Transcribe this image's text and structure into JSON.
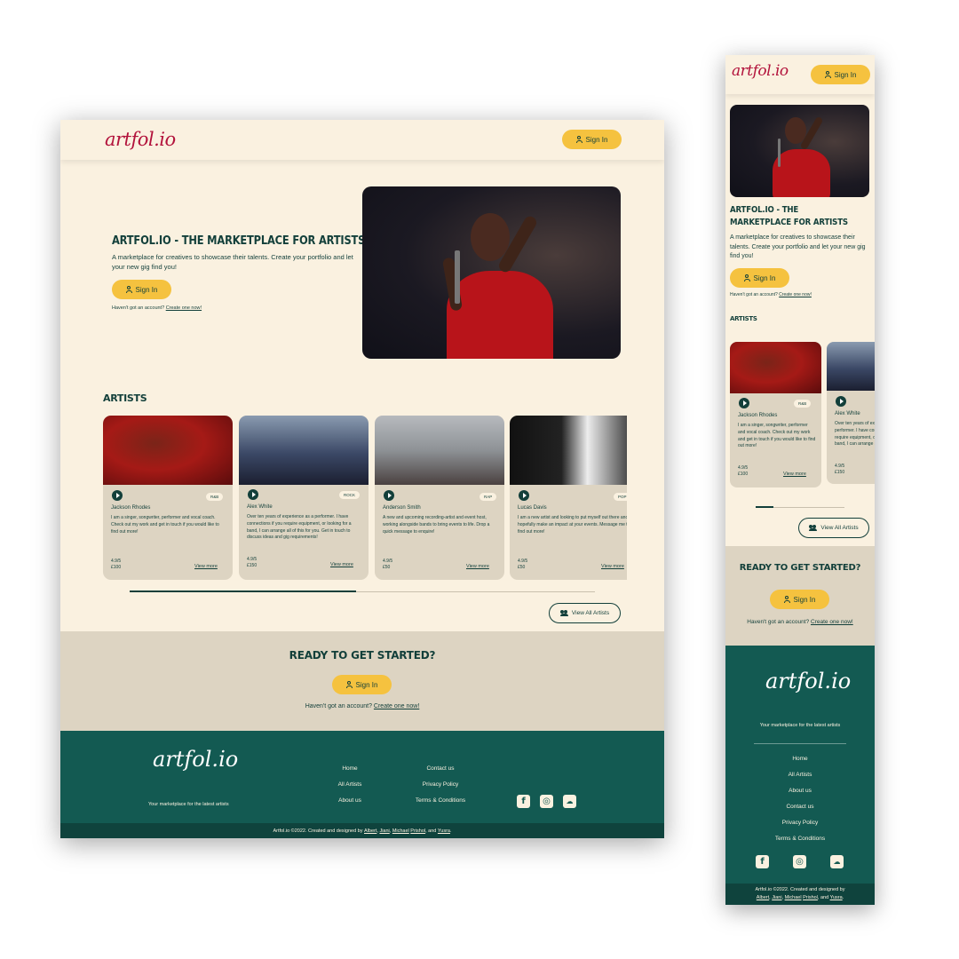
{
  "brand": {
    "logo": "artfol.io",
    "tagline": "Your marketplace for the latest artists"
  },
  "header": {
    "signin_label": "Sign In"
  },
  "hero": {
    "title": "ARTFOL.IO - THE MARKETPLACE FOR ARTISTS",
    "text": "A marketplace for creatives to showcase their talents. Create your portfolio and let your new gig find you!",
    "signin_label": "Sign In",
    "no_account": "Haven't got an account?",
    "create_link": "Create one now!"
  },
  "artists": {
    "title": "ARTISTS",
    "view_all_label": "View All Artists",
    "cards": [
      {
        "name": "Jackson Rhodes",
        "genre": "R&B",
        "desc": "I am a singer, songwriter, performer and vocal coach. Check out my work and get in touch if you would like to find out more!",
        "rating": "4.9/5",
        "price": "£100",
        "more": "View more"
      },
      {
        "name": "Alex White",
        "genre": "ROCK",
        "desc": "Over ten years of experience as a performer. I have connections if you require equipment, or looking for a band, I can arrange all of this for you. Get in touch to discuss ideas and gig requirements!",
        "rating": "4.9/5",
        "price": "£150",
        "more": "View more"
      },
      {
        "name": "Anderson Smith",
        "genre": "RAP",
        "desc": "A new and upcoming recording-artist and event host, working alongside bands to bring events to life. Drop a quick message to enquire!",
        "rating": "4.9/5",
        "price": "£50",
        "more": "View more"
      },
      {
        "name": "Lucas Davis",
        "genre": "POP",
        "desc": "I am a new artist and looking to put myself out there and hopefully make an impact at your events. Message me to find out more!",
        "rating": "4.9/5",
        "price": "£50",
        "more": "View more"
      }
    ],
    "mobile_desc_1": "I am a singer, songwriter, performer and vocal coach. Check out my work and get in touch if you would like to find out more!",
    "mobile_desc_2": "Over ten years of experience as a performer. I have connections if you require equipment, or looking for a band, I can arrange all of this"
  },
  "cta": {
    "title": "READY TO GET STARTED?",
    "signin_label": "Sign In",
    "no_account": "Haven't got an account?",
    "create_link": "Create one now!"
  },
  "footer": {
    "links": [
      "Home",
      "All Artists",
      "About us",
      "Contact us",
      "Privacy Policy",
      "Terms & Conditions"
    ],
    "social_icons": [
      "facebook-icon",
      "instagram-icon",
      "soundcloud-icon"
    ],
    "copyright_prefix": "Artfol.io ©2022. Created and designed by",
    "authors": [
      "Albert",
      "Jiani",
      "Michael",
      "Prishol",
      "Yusra"
    ],
    "and_word": "and"
  },
  "colors": {
    "cream": "#faf1e0",
    "beige": "#ddd4c2",
    "teal": "#135a52",
    "dark_teal": "#123f3a",
    "yellow": "#f5c23f",
    "logo_red": "#b2123b"
  }
}
